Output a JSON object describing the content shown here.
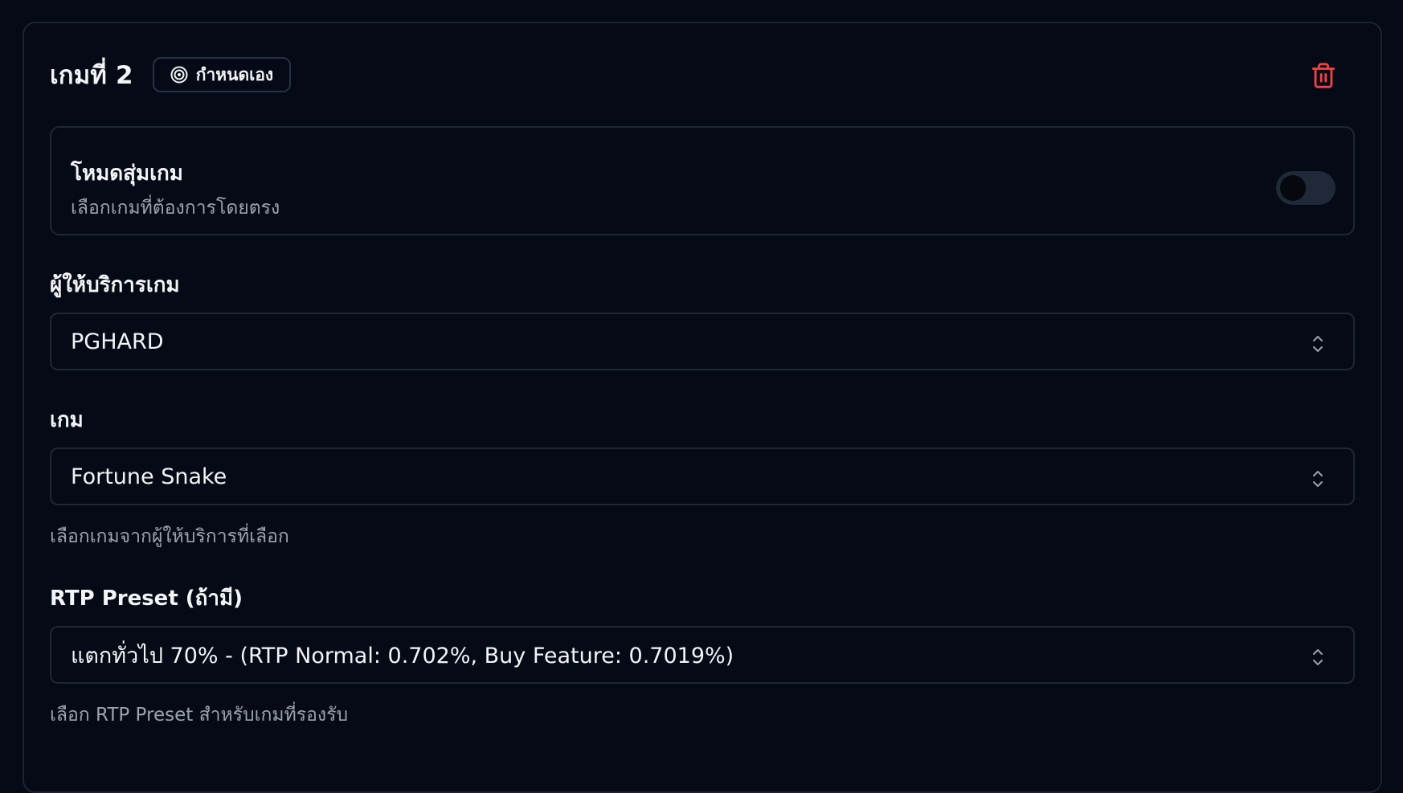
{
  "header": {
    "title": "เกมที่ 2",
    "badge_label": "กำหนดเอง",
    "badge_icon": "target-icon",
    "delete_icon": "trash-icon"
  },
  "random_mode": {
    "title": "โหมดสุ่มเกม",
    "subtitle": "เลือกเกมที่ต้องการโดยตรง",
    "enabled": false
  },
  "provider": {
    "label": "ผู้ให้บริการเกม",
    "value": "PGHARD"
  },
  "game": {
    "label": "เกม",
    "value": "Fortune Snake",
    "help": "เลือกเกมจากผู้ให้บริการที่เลือก"
  },
  "rtp": {
    "label": "RTP Preset (ถ้ามี)",
    "value": "แตกทั่วไป 70% - (RTP Normal: 0.702%, Buy Feature: 0.7019%)",
    "help": "เลือก RTP Preset สำหรับเกมที่รองรับ"
  },
  "colors": {
    "background": "#050a16",
    "border": "#1f2737",
    "danger": "#ef4444",
    "muted_text": "#9ca3af"
  }
}
